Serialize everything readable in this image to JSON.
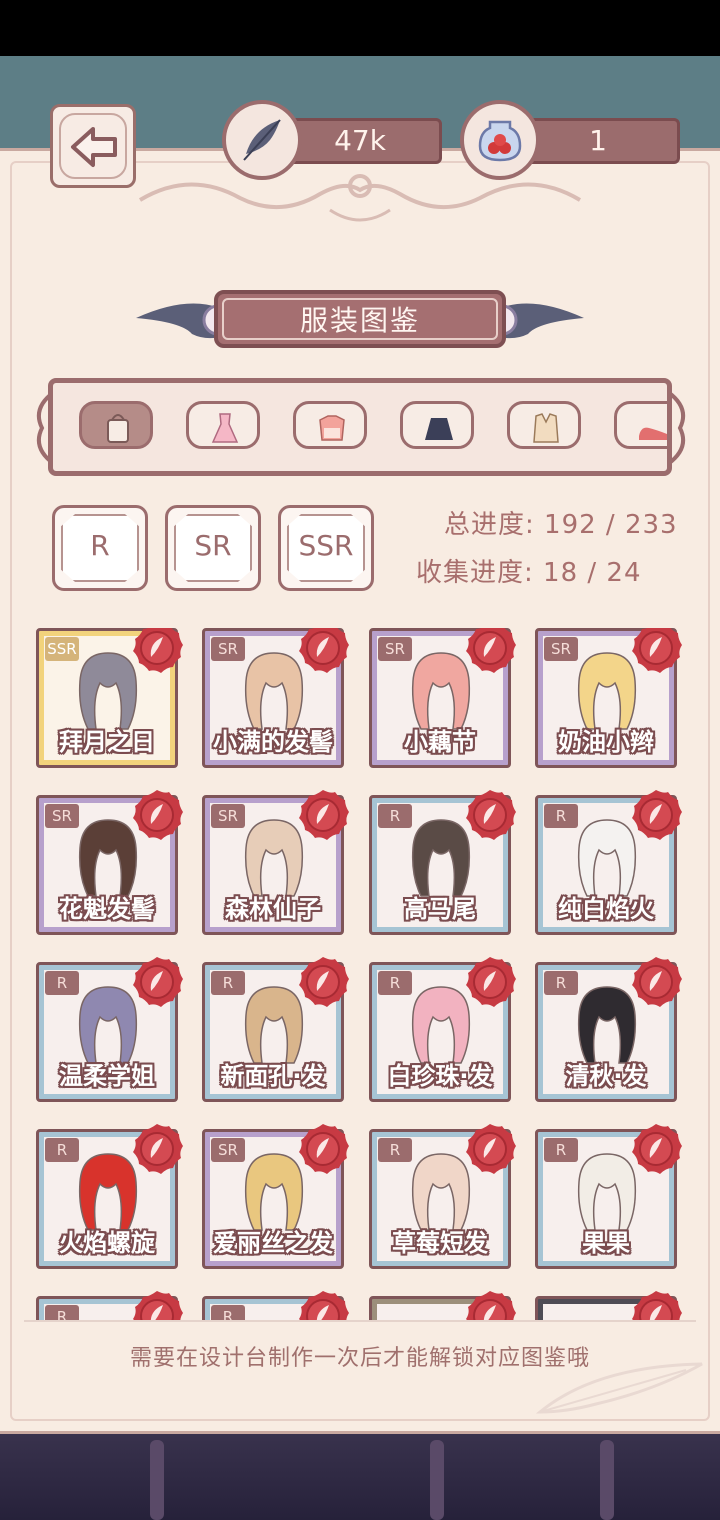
{
  "header": {
    "feather_count": "47k",
    "potion_count": "1"
  },
  "title": "服装图鉴",
  "categories": [
    {
      "icon": "bag-icon",
      "active": true
    },
    {
      "icon": "dress-icon",
      "active": false
    },
    {
      "icon": "top-icon",
      "active": false
    },
    {
      "icon": "skirt-icon",
      "active": false
    },
    {
      "icon": "coat-icon",
      "active": false
    },
    {
      "icon": "shoe-icon",
      "active": false
    }
  ],
  "rarity_filters": [
    "R",
    "SR",
    "SSR"
  ],
  "progress": {
    "total": "总进度: 192 / 233",
    "collection": "收集进度: 18 / 24"
  },
  "items": [
    {
      "rarity": "SSR",
      "name": "拜月之日",
      "hair": "#8f8a99"
    },
    {
      "rarity": "SR",
      "name": "小满的发髻",
      "hair": "#e8c3a6"
    },
    {
      "rarity": "SR",
      "name": "小藕节",
      "hair": "#f0a7a0"
    },
    {
      "rarity": "SR",
      "name": "奶油小辫",
      "hair": "#f3d58a"
    },
    {
      "rarity": "SR",
      "name": "花魁发髻",
      "hair": "#5b3f37"
    },
    {
      "rarity": "SR",
      "name": "森林仙子",
      "hair": "#e7cdb8"
    },
    {
      "rarity": "R",
      "name": "高马尾",
      "hair": "#5a4b46"
    },
    {
      "rarity": "R",
      "name": "纯白焰火",
      "hair": "#f4f2f0"
    },
    {
      "rarity": "R",
      "name": "温柔学姐",
      "hair": "#8f88b0"
    },
    {
      "rarity": "R",
      "name": "新面孔·发",
      "hair": "#d9b58c"
    },
    {
      "rarity": "R",
      "name": "白珍珠·发",
      "hair": "#f2b2c0"
    },
    {
      "rarity": "R",
      "name": "清秋·发",
      "hair": "#2f2b30"
    },
    {
      "rarity": "R",
      "name": "火焰螺旋",
      "hair": "#d8332c"
    },
    {
      "rarity": "SR",
      "name": "爱丽丝之发",
      "hair": "#e9c77f"
    },
    {
      "rarity": "R",
      "name": "草莓短发",
      "hair": "#f0d6c8"
    },
    {
      "rarity": "R",
      "name": "果果",
      "hair": "#f2ede6"
    },
    {
      "rarity": "R",
      "name": "",
      "hair": "#c7a78e"
    },
    {
      "rarity": "R",
      "name": "",
      "hair": "#6f5a55"
    },
    {
      "rarity": "locked",
      "name": "",
      "hair": "#3b302b"
    },
    {
      "rarity": "locked2",
      "name": "",
      "hair": "#2b2830"
    }
  ],
  "footer_note": "需要在设计台制作一次后才能解锁对应图鉴哦"
}
